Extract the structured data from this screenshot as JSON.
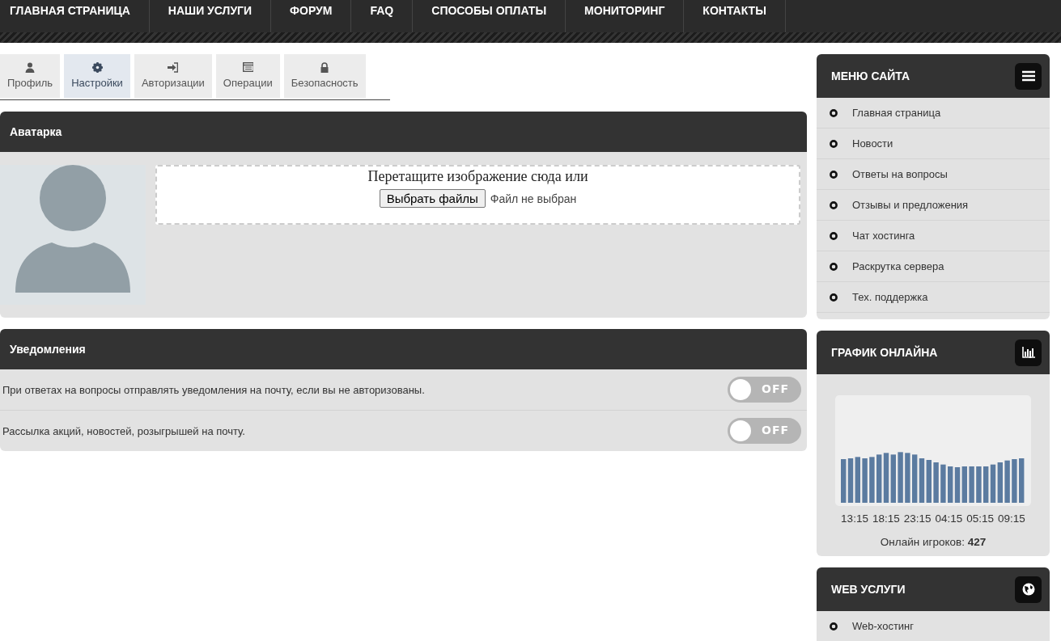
{
  "nav": {
    "items": [
      {
        "label": "ГЛАВНАЯ СТРАНИЦА"
      },
      {
        "label": "НАШИ УСЛУГИ"
      },
      {
        "label": "ФОРУМ"
      },
      {
        "label": "FAQ"
      },
      {
        "label": "СПОСОБЫ ОПЛАТЫ"
      },
      {
        "label": "МОНИТОРИНГ"
      },
      {
        "label": "КОНТАКТЫ"
      }
    ]
  },
  "tabs": [
    {
      "label": "Профиль",
      "selected": false
    },
    {
      "label": "Настройки",
      "selected": true
    },
    {
      "label": "Авторизации",
      "selected": false
    },
    {
      "label": "Операции",
      "selected": false
    },
    {
      "label": "Безопасность",
      "selected": false
    }
  ],
  "avatar_panel": {
    "title": "Аватарка",
    "dropzone": {
      "prompt": "Перетащите изображение сюда или",
      "button": "Выбрать файлы",
      "file_status": "Файл не выбран"
    }
  },
  "notifications": {
    "title": "Уведомления",
    "settings": [
      {
        "label": "При ответах на вопросы отправлять уведомления на почту, если вы не авторизованы.",
        "on": false,
        "switch_text": "OFF"
      },
      {
        "label": "Рассылка акций, новостей, розыгрышей на почту.",
        "on": false,
        "switch_text": "OFF"
      }
    ]
  },
  "sidebar": {
    "site_menu": {
      "title": "МЕНЮ САЙТА",
      "items": [
        "Главная страница",
        "Новости",
        "Ответы на вопросы",
        "Отзывы и предложения",
        "Чат хостинга",
        "Раскрутка сервера",
        "Тех. поддержка"
      ]
    },
    "online_chart": {
      "title": "ГРАФИК ОНЛАЙНА",
      "time_labels": [
        "13:15",
        "18:15",
        "23:15",
        "04:15",
        "05:15",
        "09:15"
      ],
      "online_text": "Онлайн игроков: **427**"
    },
    "web_services": {
      "title": "WEB УСЛУГИ",
      "items": [
        "Web-хостинг"
      ]
    }
  }
}
